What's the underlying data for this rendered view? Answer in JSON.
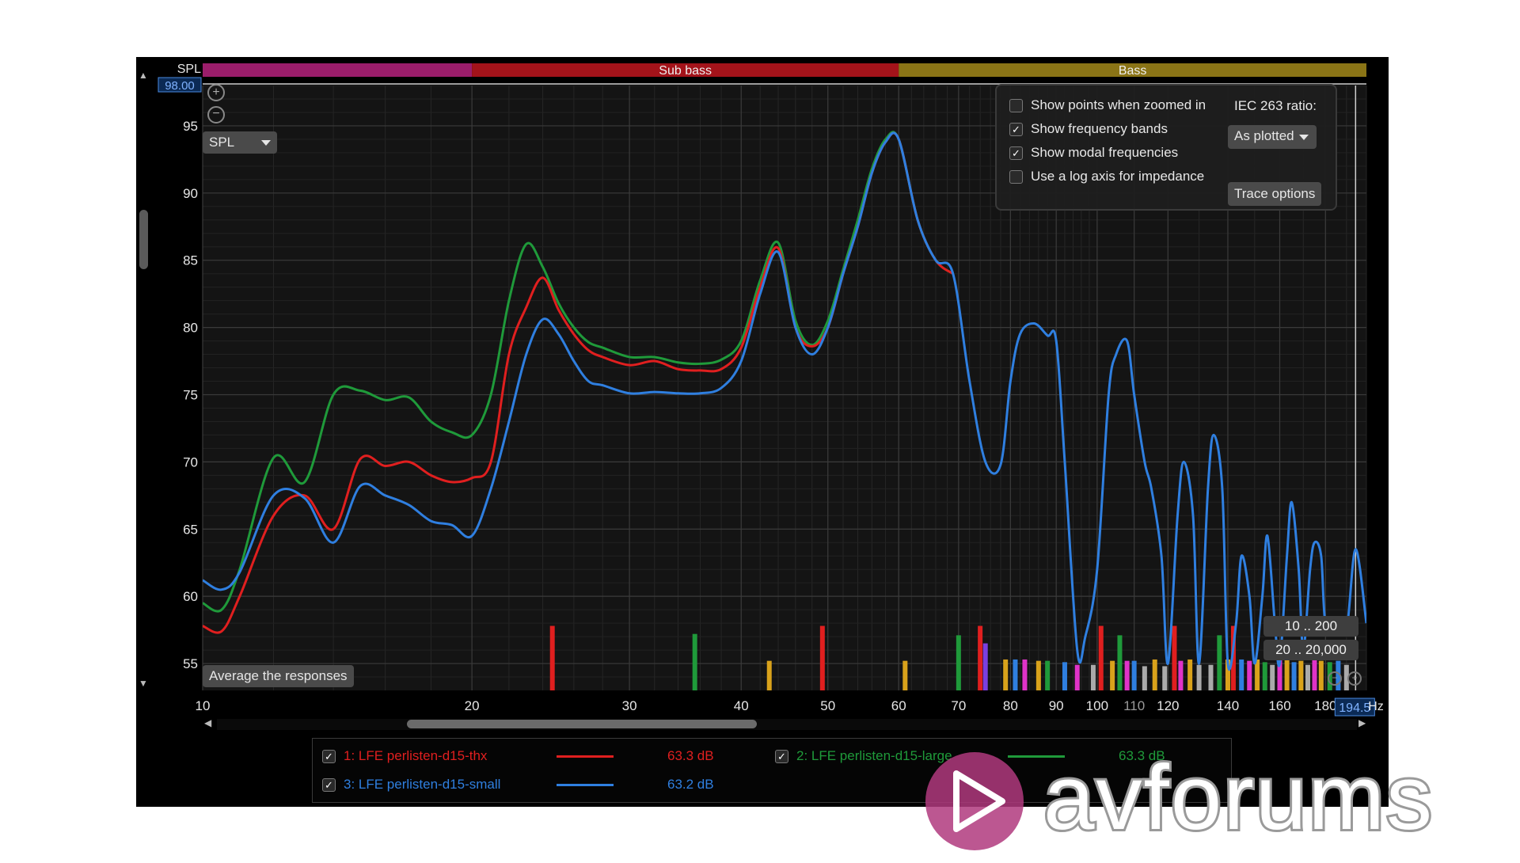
{
  "colors": {
    "series1": "#e01f1f",
    "series2": "#1f9a3a",
    "series3": "#2f7fe0",
    "band_infra": "#9b1d6b",
    "band_subbass": "#a3131a",
    "band_bass": "#8a7416",
    "grid": "#3a3a3a",
    "axis_text": "#e6e6e6"
  },
  "header": {
    "spl_label": "SPL",
    "y_max_value": "98.00",
    "x_cursor_value": "194.5",
    "hz_unit": "Hz"
  },
  "bands": [
    {
      "label": "",
      "from": 10,
      "to": 20
    },
    {
      "label": "Sub bass",
      "from": 20,
      "to": 60
    },
    {
      "label": "Bass",
      "from": 60,
      "to": 200
    }
  ],
  "controls": {
    "spl_select": "SPL",
    "zoom_in_icon": "zoom-in-icon",
    "zoom_out_icon": "zoom-out-icon",
    "average_button": "Average the responses",
    "range_buttons": [
      "10 .. 200",
      "20 .. 20,000"
    ]
  },
  "options": {
    "show_points": {
      "label": "Show points when zoomed in",
      "checked": false
    },
    "show_bands": {
      "label": "Show frequency bands",
      "checked": true
    },
    "show_modal": {
      "label": "Show modal frequencies",
      "checked": true
    },
    "log_axis": {
      "label": "Use a log axis for impedance",
      "checked": false
    },
    "iec_label": "IEC 263 ratio:",
    "iec_value": "As plotted",
    "trace_button": "Trace options"
  },
  "legend": [
    {
      "label": "1: LFE perlisten-d15-thx",
      "value": "63.3 dB",
      "checked": true,
      "color": "#e01f1f"
    },
    {
      "label": "2: LFE perlisten-d15-large",
      "value": "63.3 dB",
      "checked": true,
      "color": "#1f9a3a"
    },
    {
      "label": "3: LFE perlisten-d15-small",
      "value": "63.2 dB",
      "checked": true,
      "color": "#2f7fe0"
    }
  ],
  "watermark": {
    "text": "avforums"
  },
  "chart_data": {
    "type": "line",
    "xlabel": "",
    "ylabel": "SPL",
    "x_scale": "log",
    "xlim": [
      10,
      200
    ],
    "ylim": [
      53,
      98
    ],
    "x_ticks": [
      10,
      20,
      30,
      40,
      50,
      60,
      70,
      80,
      90,
      100,
      110,
      120,
      140,
      160,
      180
    ],
    "y_ticks": [
      55,
      60,
      65,
      70,
      75,
      80,
      85,
      90,
      95
    ],
    "grid": true,
    "series": [
      {
        "name": "1: LFE perlisten-d15-thx",
        "x": [
          10,
          10.5,
          11,
          12,
          13,
          14,
          15,
          16,
          17,
          18,
          19,
          20,
          21,
          22,
          23,
          24,
          25,
          26,
          27,
          28,
          30,
          32,
          34,
          36,
          38,
          40,
          42,
          44,
          46,
          48,
          50,
          52,
          54,
          56,
          58,
          60,
          63,
          66,
          69
        ],
        "y": [
          57.8,
          57.4,
          60,
          66,
          67.5,
          65,
          70.2,
          69.7,
          70,
          69,
          68.5,
          68.8,
          70,
          78,
          81.5,
          83.7,
          81.3,
          79.5,
          78.3,
          77.8,
          77.2,
          77.5,
          76.9,
          76.8,
          76.9,
          78.5,
          83,
          85.9,
          80,
          78.6,
          80,
          84,
          87.5,
          91.5,
          93.8,
          94,
          88,
          85,
          84
        ]
      },
      {
        "name": "2: LFE perlisten-d15-large",
        "x": [
          10,
          10.5,
          11,
          12,
          13,
          14,
          15,
          16,
          17,
          18,
          19,
          20,
          21,
          22,
          23,
          24,
          25,
          26,
          27,
          28,
          30,
          32,
          34,
          36,
          38,
          40,
          42,
          44,
          46,
          48,
          50,
          52,
          54,
          56,
          58,
          60,
          63,
          66,
          69
        ],
        "y": [
          59.5,
          59,
          62,
          70.3,
          68.5,
          75,
          75.3,
          74.6,
          74.8,
          73,
          72.2,
          72,
          75,
          82,
          86.2,
          84.5,
          81.8,
          80,
          78.9,
          78.5,
          77.8,
          77.8,
          77.4,
          77.3,
          77.6,
          79,
          83.5,
          86.3,
          80.5,
          78.7,
          80.5,
          84.3,
          88,
          91.8,
          94,
          94,
          88,
          85,
          84
        ]
      },
      {
        "name": "3: LFE perlisten-d15-small",
        "x": [
          10,
          10.5,
          11,
          12,
          13,
          14,
          15,
          16,
          17,
          18,
          19,
          20,
          21,
          22,
          23,
          24,
          25,
          26,
          27,
          28,
          30,
          32,
          34,
          36,
          38,
          40,
          42,
          44,
          46,
          48,
          50,
          52,
          54,
          56,
          58,
          60,
          63,
          66,
          69,
          72,
          75,
          78,
          80,
          82,
          85,
          88,
          90,
          92,
          95,
          97,
          100,
          103,
          105,
          108,
          110,
          113,
          115,
          118,
          120,
          123,
          125,
          128,
          130,
          133,
          135,
          138,
          140,
          143,
          145,
          148,
          150,
          153,
          155,
          158,
          160,
          163,
          165,
          168,
          170,
          173,
          175,
          178,
          180,
          185,
          190,
          194.5,
          200
        ],
        "y": [
          61.2,
          60.5,
          61.8,
          67.5,
          67.3,
          64,
          68.2,
          67.5,
          66.8,
          65.6,
          65.3,
          64.5,
          68,
          73,
          78,
          80.6,
          79.5,
          77.5,
          76,
          75.7,
          75.1,
          75.2,
          75.1,
          75.1,
          75.5,
          77.5,
          82.5,
          85.6,
          80,
          78,
          80,
          84,
          87.5,
          91.5,
          93.8,
          94,
          88,
          85,
          84,
          76,
          70,
          69.8,
          76,
          79.5,
          80.3,
          79.4,
          79,
          70,
          56,
          57,
          62,
          75,
          78,
          79,
          75,
          70,
          68,
          63,
          55,
          66,
          70,
          66,
          55,
          68,
          72,
          68,
          55,
          58,
          63,
          60,
          55,
          60,
          64.5,
          58,
          55,
          63,
          67,
          62,
          56,
          62,
          64,
          63,
          58,
          58,
          57.5,
          63.5,
          58
        ]
      }
    ],
    "modal_markers": [
      {
        "x": 24.6,
        "h": 57.8,
        "color": "#e01f1f"
      },
      {
        "x": 35.5,
        "h": 57.2,
        "color": "#1f9a3a"
      },
      {
        "x": 43,
        "h": 55.2,
        "color": "#d9a21b"
      },
      {
        "x": 49.3,
        "h": 57.8,
        "color": "#e01f1f"
      },
      {
        "x": 61,
        "h": 55.2,
        "color": "#d9a21b"
      },
      {
        "x": 70,
        "h": 57.1,
        "color": "#1f9a3a"
      },
      {
        "x": 74,
        "h": 57.8,
        "color": "#e01f1f"
      },
      {
        "x": 75,
        "h": 56.5,
        "color": "#7b3fe0"
      },
      {
        "x": 79,
        "h": 55.3,
        "color": "#d9a21b"
      },
      {
        "x": 81,
        "h": 55.3,
        "color": "#2f7fe0"
      },
      {
        "x": 83,
        "h": 55.3,
        "color": "#e033c8"
      },
      {
        "x": 86,
        "h": 55.2,
        "color": "#d9a21b"
      },
      {
        "x": 88,
        "h": 55.2,
        "color": "#1f9a3a"
      },
      {
        "x": 92,
        "h": 55.1,
        "color": "#2f7fe0"
      },
      {
        "x": 95,
        "h": 54.9,
        "color": "#e033c8"
      },
      {
        "x": 99,
        "h": 54.9,
        "color": "#aaaaaa"
      },
      {
        "x": 101,
        "h": 57.8,
        "color": "#e01f1f"
      },
      {
        "x": 104,
        "h": 55.2,
        "color": "#d9a21b"
      },
      {
        "x": 106,
        "h": 57.1,
        "color": "#1f9a3a"
      },
      {
        "x": 108,
        "h": 55.2,
        "color": "#e033c8"
      },
      {
        "x": 110,
        "h": 55.2,
        "color": "#2f7fe0"
      },
      {
        "x": 113,
        "h": 54.8,
        "color": "#aaaaaa"
      },
      {
        "x": 116,
        "h": 55.3,
        "color": "#d9a21b"
      },
      {
        "x": 119,
        "h": 54.8,
        "color": "#aaaaaa"
      },
      {
        "x": 122,
        "h": 57.8,
        "color": "#e01f1f"
      },
      {
        "x": 124,
        "h": 55.2,
        "color": "#e033c8"
      },
      {
        "x": 127,
        "h": 55.3,
        "color": "#d9a21b"
      },
      {
        "x": 130,
        "h": 54.9,
        "color": "#aaaaaa"
      },
      {
        "x": 134,
        "h": 54.9,
        "color": "#aaaaaa"
      },
      {
        "x": 137,
        "h": 57.1,
        "color": "#1f9a3a"
      },
      {
        "x": 140,
        "h": 55.3,
        "color": "#d9a21b"
      },
      {
        "x": 142,
        "h": 57.8,
        "color": "#e01f1f"
      },
      {
        "x": 145,
        "h": 55.3,
        "color": "#2f7fe0"
      },
      {
        "x": 148,
        "h": 55.2,
        "color": "#e033c8"
      },
      {
        "x": 151,
        "h": 55.3,
        "color": "#d9a21b"
      },
      {
        "x": 154,
        "h": 55.1,
        "color": "#1f9a3a"
      },
      {
        "x": 157,
        "h": 54.9,
        "color": "#aaaaaa"
      },
      {
        "x": 160,
        "h": 55.3,
        "color": "#e033c8"
      },
      {
        "x": 163,
        "h": 55.3,
        "color": "#d9a21b"
      },
      {
        "x": 166,
        "h": 55.1,
        "color": "#2f7fe0"
      },
      {
        "x": 169,
        "h": 55.2,
        "color": "#d9a21b"
      },
      {
        "x": 172,
        "h": 54.9,
        "color": "#aaaaaa"
      },
      {
        "x": 175,
        "h": 55.3,
        "color": "#e033c8"
      },
      {
        "x": 178,
        "h": 55.2,
        "color": "#d9a21b"
      },
      {
        "x": 182,
        "h": 55.1,
        "color": "#1f9a3a"
      },
      {
        "x": 186,
        "h": 55.2,
        "color": "#2f7fe0"
      },
      {
        "x": 190,
        "h": 54.9,
        "color": "#aaaaaa"
      }
    ]
  }
}
